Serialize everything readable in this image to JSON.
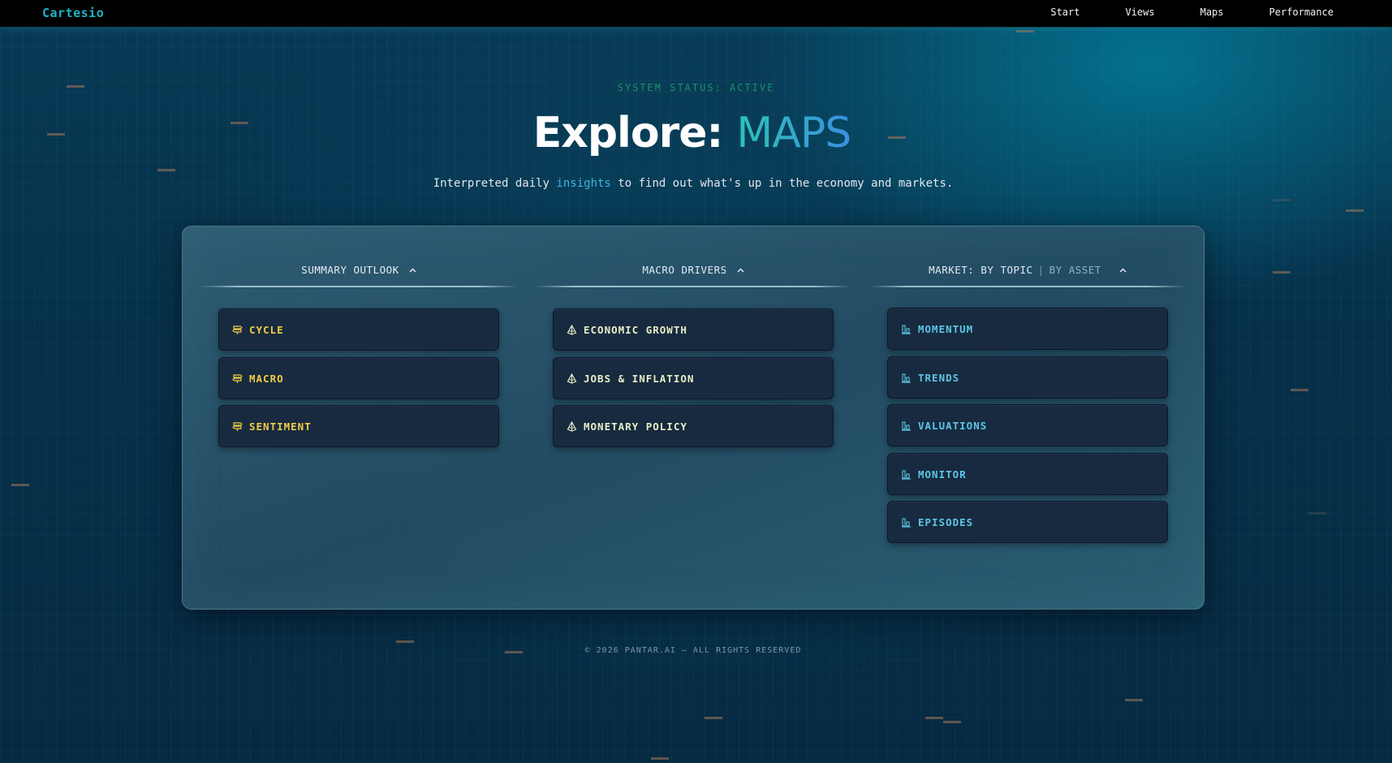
{
  "topbar": {
    "brand": "Cartesio",
    "nav": [
      {
        "label": "Start"
      },
      {
        "label": "Views"
      },
      {
        "label": "Maps"
      },
      {
        "label": "Performance"
      }
    ]
  },
  "hero": {
    "status": "SYSTEM STATUS: ACTIVE",
    "title_prefix": "Explore:",
    "title_accent": "MAPS",
    "subtitle_before": "Interpreted daily",
    "subtitle_link": "insights",
    "subtitle_after": "to find out what's up in the economy and markets."
  },
  "columns": [
    {
      "header": "SUMMARY OUTLOOK",
      "icon": "signpost-icon",
      "items": [
        {
          "label": "CYCLE"
        },
        {
          "label": "MACRO"
        },
        {
          "label": "SENTIMENT"
        }
      ]
    },
    {
      "header": "MACRO DRIVERS",
      "icon": "compass-diamond-icon",
      "items": [
        {
          "label": "ECONOMIC GROWTH"
        },
        {
          "label": "JOBS & INFLATION"
        },
        {
          "label": "MONETARY POLICY"
        }
      ]
    },
    {
      "header_prefix": "MARKET:",
      "header_active": "BY TOPIC",
      "header_separator": "|",
      "header_inactive": "BY ASSET",
      "icon": "bar-chart-icon",
      "items": [
        {
          "label": "MOMENTUM"
        },
        {
          "label": "TRENDS"
        },
        {
          "label": "VALUATIONS"
        },
        {
          "label": "MONITOR"
        },
        {
          "label": "EPISODES"
        }
      ]
    }
  ],
  "footer": {
    "copyright": "© 2026 PANTAR.AI — ALL RIGHTS RESERVED"
  },
  "colors": {
    "summary_accent": "#f1cd45",
    "macro_accent": "#e6edc8",
    "market_accent": "#5cc6e6",
    "title_gradient_start": "#2cc4b4",
    "title_gradient_end": "#3a8fe0"
  }
}
